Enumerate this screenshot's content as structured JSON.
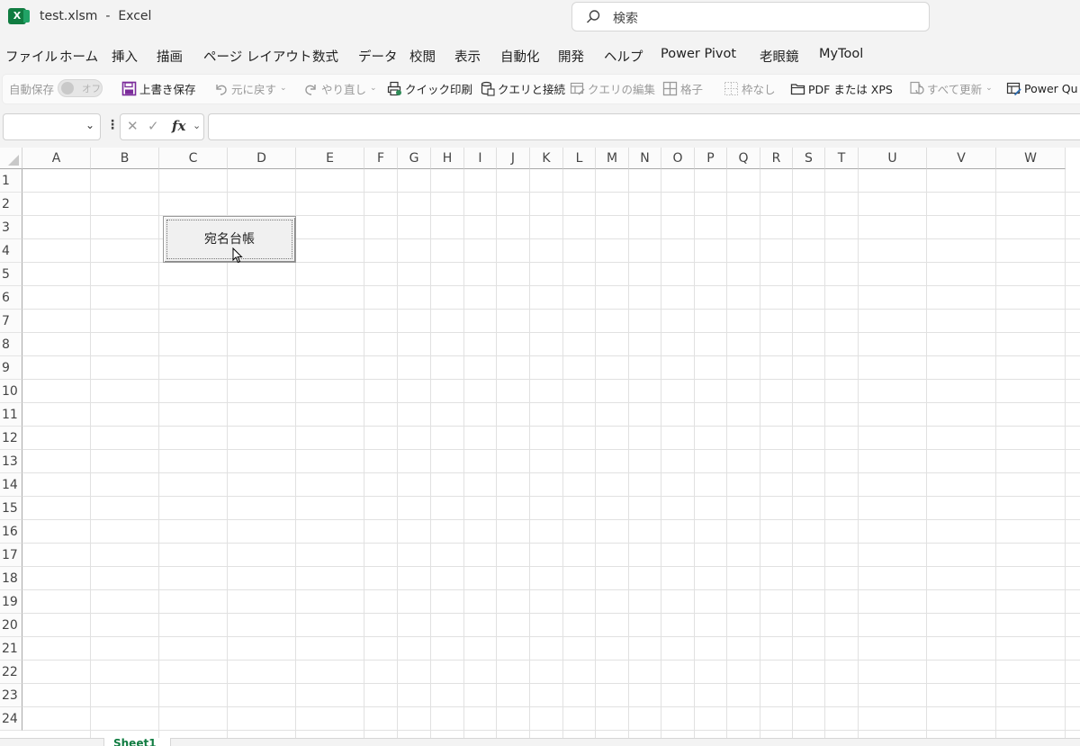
{
  "window": {
    "filename": "test.xlsm",
    "separator": "-",
    "app_name": "Excel",
    "search_placeholder": "検索"
  },
  "menu_tabs": [
    "ファイル",
    "ホーム",
    "挿入",
    "描画",
    "ページ レイアウト",
    "数式",
    "データ",
    "校閲",
    "表示",
    "自動化",
    "開発",
    "ヘルプ",
    "Power Pivot",
    "老眼鏡",
    "MyTool"
  ],
  "quick_access": {
    "autosave_label": "自動保存",
    "autosave_state": "オフ",
    "overwrite_save": "上書き保存",
    "undo": "元に戻す",
    "redo": "やり直し",
    "quick_print": "クイック印刷",
    "queries_connections": "クエリと接続",
    "edit_query": "クエリの編集",
    "grid": "格子",
    "no_border": "枠なし",
    "pdf_xps": "PDF または XPS",
    "refresh_all": "すべて更新",
    "power_query": "Power Qu"
  },
  "formula_bar": {
    "name_box_value": "",
    "fx_label": "fx",
    "formula_value": ""
  },
  "columns": [
    "A",
    "B",
    "C",
    "D",
    "E",
    "F",
    "G",
    "H",
    "I",
    "J",
    "K",
    "L",
    "M",
    "N",
    "O",
    "P",
    "Q",
    "R",
    "S",
    "T",
    "U",
    "V",
    "W"
  ],
  "rows": [
    "1",
    "2",
    "3",
    "4",
    "5",
    "6",
    "7",
    "8",
    "9",
    "10",
    "11",
    "12",
    "13",
    "14",
    "15",
    "16",
    "17",
    "18",
    "19",
    "20",
    "21",
    "22",
    "23",
    "24"
  ],
  "sheet_button": {
    "label": "宛名台帳"
  },
  "sheet_tabs": [
    "Sheet1"
  ]
}
